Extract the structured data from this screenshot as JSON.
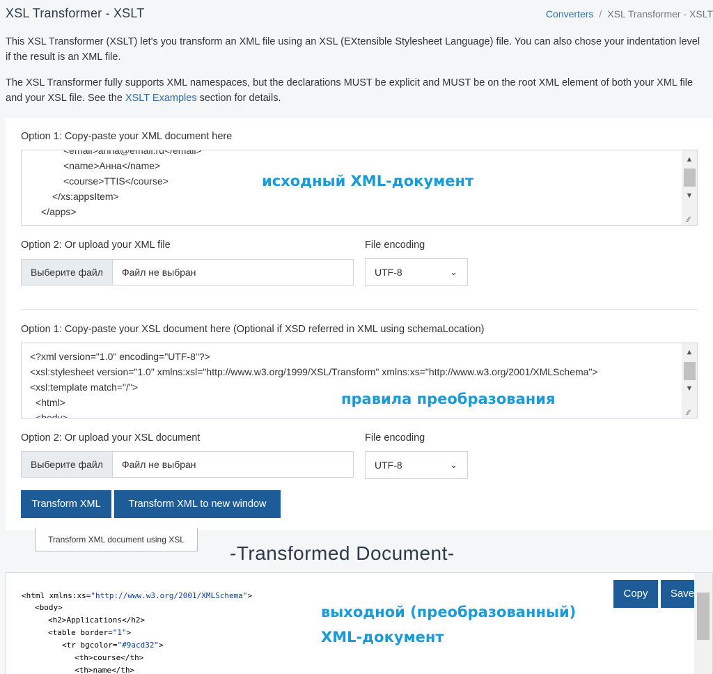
{
  "header": {
    "title": "XSL Transformer - XSLT",
    "breadcrumb": {
      "link": "Converters",
      "separator": "/",
      "current": "XSL Transformer - XSLT"
    }
  },
  "description": {
    "p1": "This XSL Transformer (XSLT) let's you transform an XML file using an XSL (EXtensible Stylesheet Language) file. You can also chose your indentation level if the result is an XML file.",
    "p2_before": "The XSL Transformer fully supports XML namespaces, but the declarations MUST be explicit and MUST be on the root XML element of both your XML file and your XSL file. See the ",
    "p2_link": "XSLT Examples",
    "p2_after": " section for details."
  },
  "xml_section": {
    "option1_label": "Option 1: Copy-paste your XML document here",
    "lines": [
      "<email>anna@email.ru</email>",
      "<name>Анна</name>",
      "<course>TTIS</course>",
      "</xs:appsItem>",
      "</apps>"
    ],
    "overlay_label": "исходный XML-документ",
    "option2_label": "Option 2: Or upload your XML file",
    "encoding_label": "File encoding",
    "file_button": "Выберите файл",
    "file_status": "Файл не выбран",
    "encoding_value": "UTF-8"
  },
  "xsl_section": {
    "option1_label": "Option 1: Copy-paste your XSL document here (Optional if XSD referred in XML using schemaLocation)",
    "lines": [
      "<?xml version=\"1.0\" encoding=\"UTF-8\"?>",
      "<xsl:stylesheet version=\"1.0\" xmlns:xsl=\"http://www.w3.org/1999/XSL/Transform\" xmlns:xs=\"http://www.w3.org/2001/XMLSchema\">",
      "<xsl:template match=\"/\">",
      "<html>",
      "<body>"
    ],
    "overlay_label": "правила преобразования",
    "option2_label": "Option 2: Or upload your XSL document",
    "encoding_label": "File encoding",
    "file_button": "Выберите файл",
    "file_status": "Файл не выбран",
    "encoding_value": "UTF-8"
  },
  "actions": {
    "transform": "Transform XML",
    "transform_new_window": "Transform XML to new window",
    "tooltip": "Transform XML document using XSL"
  },
  "output": {
    "heading": "-Transformed Document-",
    "overlay_label_line1": "выходной (преобразованный)",
    "overlay_label_line2": "XML-документ",
    "copy": "Copy",
    "save": "Save",
    "lines": [
      {
        "indent": 0,
        "tag": "<html xmlns:xs=",
        "str": "\"http://www.w3.org/2001/XMLSchema\"",
        "end": ">"
      },
      {
        "indent": 1,
        "tag": "<body>",
        "str": "",
        "end": ""
      },
      {
        "indent": 2,
        "tag": "<h2>Applications</h2>",
        "str": "",
        "end": ""
      },
      {
        "indent": 2,
        "tag": "<table border=",
        "str": "\"1\"",
        "end": ">"
      },
      {
        "indent": 3,
        "tag": "<tr bgcolor=",
        "str": "\"#9acd32\"",
        "end": ">"
      },
      {
        "indent": 4,
        "tag": "<th>course</th>",
        "str": "",
        "end": ""
      },
      {
        "indent": 4,
        "tag": "<th>name</th>",
        "str": "",
        "end": ""
      }
    ]
  },
  "colors": {
    "primary_button": "#1d5c96",
    "link": "#2f6fb0",
    "annotation": "#1a9ad8"
  }
}
